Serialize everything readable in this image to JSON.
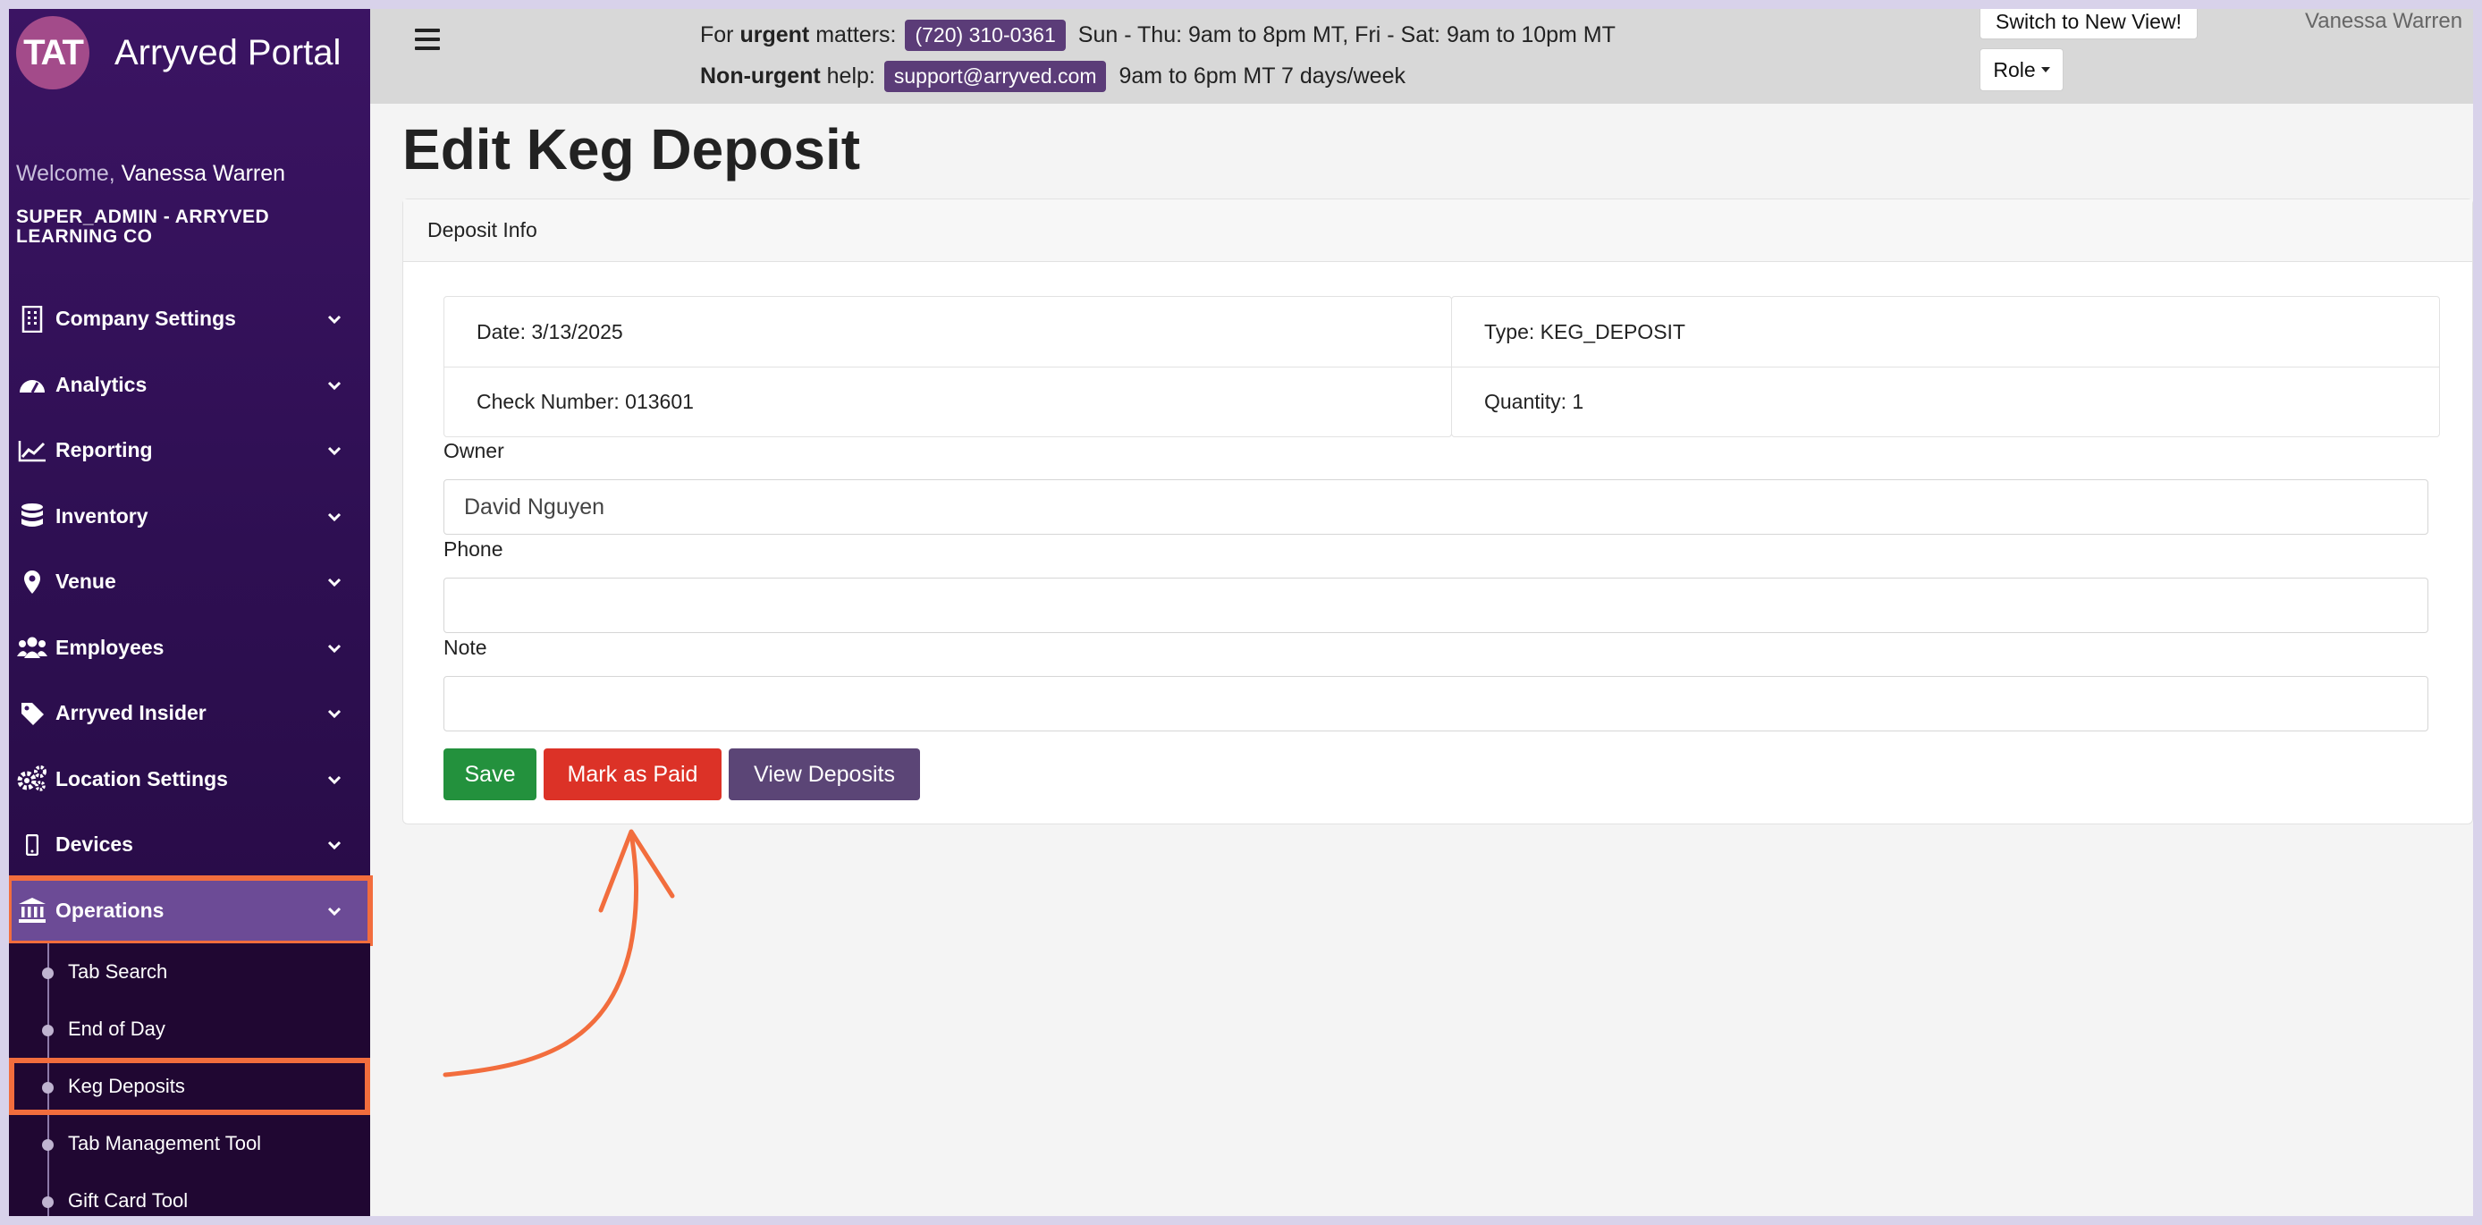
{
  "brand": {
    "logo_text": "TAT",
    "name": "Arryved Portal"
  },
  "welcome": {
    "label": "Welcome,",
    "user": "Vanessa Warren"
  },
  "company": "SUPER_ADMIN - ARRYVED LEARNING CO",
  "nav": [
    {
      "label": "Company Settings",
      "icon": "building-icon"
    },
    {
      "label": "Analytics",
      "icon": "speedometer-icon"
    },
    {
      "label": "Reporting",
      "icon": "chart-line-icon"
    },
    {
      "label": "Inventory",
      "icon": "database-icon"
    },
    {
      "label": "Venue",
      "icon": "map-pin-icon"
    },
    {
      "label": "Employees",
      "icon": "users-icon"
    },
    {
      "label": "Arryved Insider",
      "icon": "tag-icon"
    },
    {
      "label": "Location Settings",
      "icon": "gears-icon"
    },
    {
      "label": "Devices",
      "icon": "mobile-icon"
    },
    {
      "label": "Operations",
      "icon": "bank-icon",
      "active": true
    }
  ],
  "subnav": [
    {
      "label": "Tab Search"
    },
    {
      "label": "End of Day"
    },
    {
      "label": "Keg Deposits",
      "active": true
    },
    {
      "label": "Tab Management Tool"
    },
    {
      "label": "Gift Card Tool"
    }
  ],
  "topbar": {
    "urgent_prefix": "For",
    "urgent_bold": "urgent",
    "urgent_suffix": "matters:",
    "phone": "(720) 310-0361",
    "urgent_hours": "Sun - Thu: 9am to 8pm MT, Fri - Sat: 9am to 10pm MT",
    "nonurgent_bold": "Non-urgent",
    "nonurgent_suffix": "help:",
    "email": "support@arryved.com",
    "nonurgent_hours": "9am to 6pm MT 7 days/week",
    "switch_label": "Switch to New View!",
    "role_label": "Role",
    "user": "Vanessa Warren"
  },
  "page": {
    "title": "Edit Keg Deposit",
    "card_header": "Deposit Info",
    "date": "Date: 3/13/2025",
    "check_number": "Check Number: 013601",
    "type": "Type: KEG_DEPOSIT",
    "quantity": "Quantity: 1",
    "owner_label": "Owner",
    "owner_value": "David Nguyen",
    "phone_label": "Phone",
    "phone_value": "",
    "note_label": "Note",
    "note_value": "",
    "save_label": "Save",
    "mark_paid_label": "Mark as Paid",
    "view_deposits_label": "View Deposits"
  },
  "colors": {
    "sidebar": "#3b1463",
    "accent_purple": "#5b3c78",
    "highlight": "#f26d3d",
    "save": "#23913d",
    "mark_paid": "#dc3227",
    "view_deposits": "#5b4576"
  }
}
